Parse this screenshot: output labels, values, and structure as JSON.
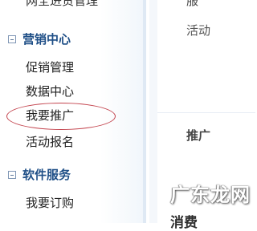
{
  "sidebar": {
    "cutoff_item": "网全进货管理",
    "sections": [
      {
        "title": "营销中心",
        "items": [
          "促销管理",
          "数据中心",
          "我要推广",
          "活动报名"
        ]
      },
      {
        "title": "软件服务",
        "items": [
          "我要订购"
        ]
      }
    ]
  },
  "main": {
    "top_cut": "服",
    "activity": "活动",
    "recommend": "推广",
    "bottom_cut": "消费"
  },
  "watermark": "广东龙网"
}
